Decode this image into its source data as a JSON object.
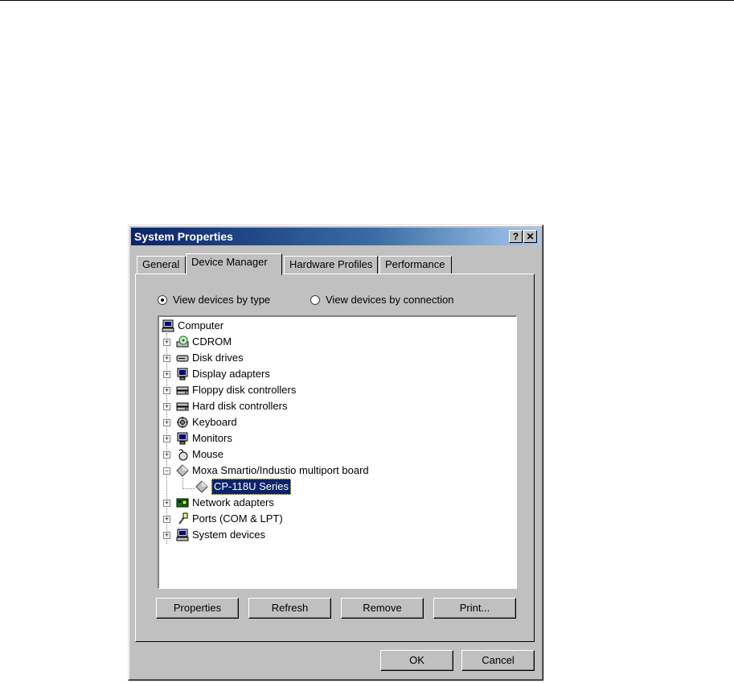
{
  "window": {
    "title": "System Properties",
    "help_label": "?",
    "close_label": "✕"
  },
  "tabs": [
    "General",
    "Device Manager",
    "Hardware Profiles",
    "Performance"
  ],
  "radios": [
    {
      "label": "View devices by type",
      "selected": true
    },
    {
      "label": "View devices by connection",
      "selected": false
    }
  ],
  "tree": [
    {
      "label": "Computer",
      "icon": "computer-icon"
    },
    {
      "label": "CDROM",
      "icon": "cdrom-icon"
    },
    {
      "label": "Disk drives",
      "icon": "disk-drive-icon"
    },
    {
      "label": "Display adapters",
      "icon": "monitor-icon"
    },
    {
      "label": "Floppy disk controllers",
      "icon": "controller-icon"
    },
    {
      "label": "Hard disk controllers",
      "icon": "controller-icon"
    },
    {
      "label": "Keyboard",
      "icon": "keyboard-icon"
    },
    {
      "label": "Monitors",
      "icon": "monitor-icon"
    },
    {
      "label": "Mouse",
      "icon": "mouse-icon"
    },
    {
      "label": "Moxa Smartio/Industio multiport board",
      "icon": "diamond-icon"
    },
    {
      "label": "CP-118U Series",
      "icon": "diamond-icon"
    },
    {
      "label": "Network adapters",
      "icon": "network-card-icon"
    },
    {
      "label": "Ports (COM & LPT)",
      "icon": "port-icon"
    },
    {
      "label": "System devices",
      "icon": "computer-icon"
    }
  ],
  "buttons": {
    "properties": "Properties",
    "refresh": "Refresh",
    "remove": "Remove",
    "print": "Print...",
    "ok": "OK",
    "cancel": "Cancel"
  }
}
